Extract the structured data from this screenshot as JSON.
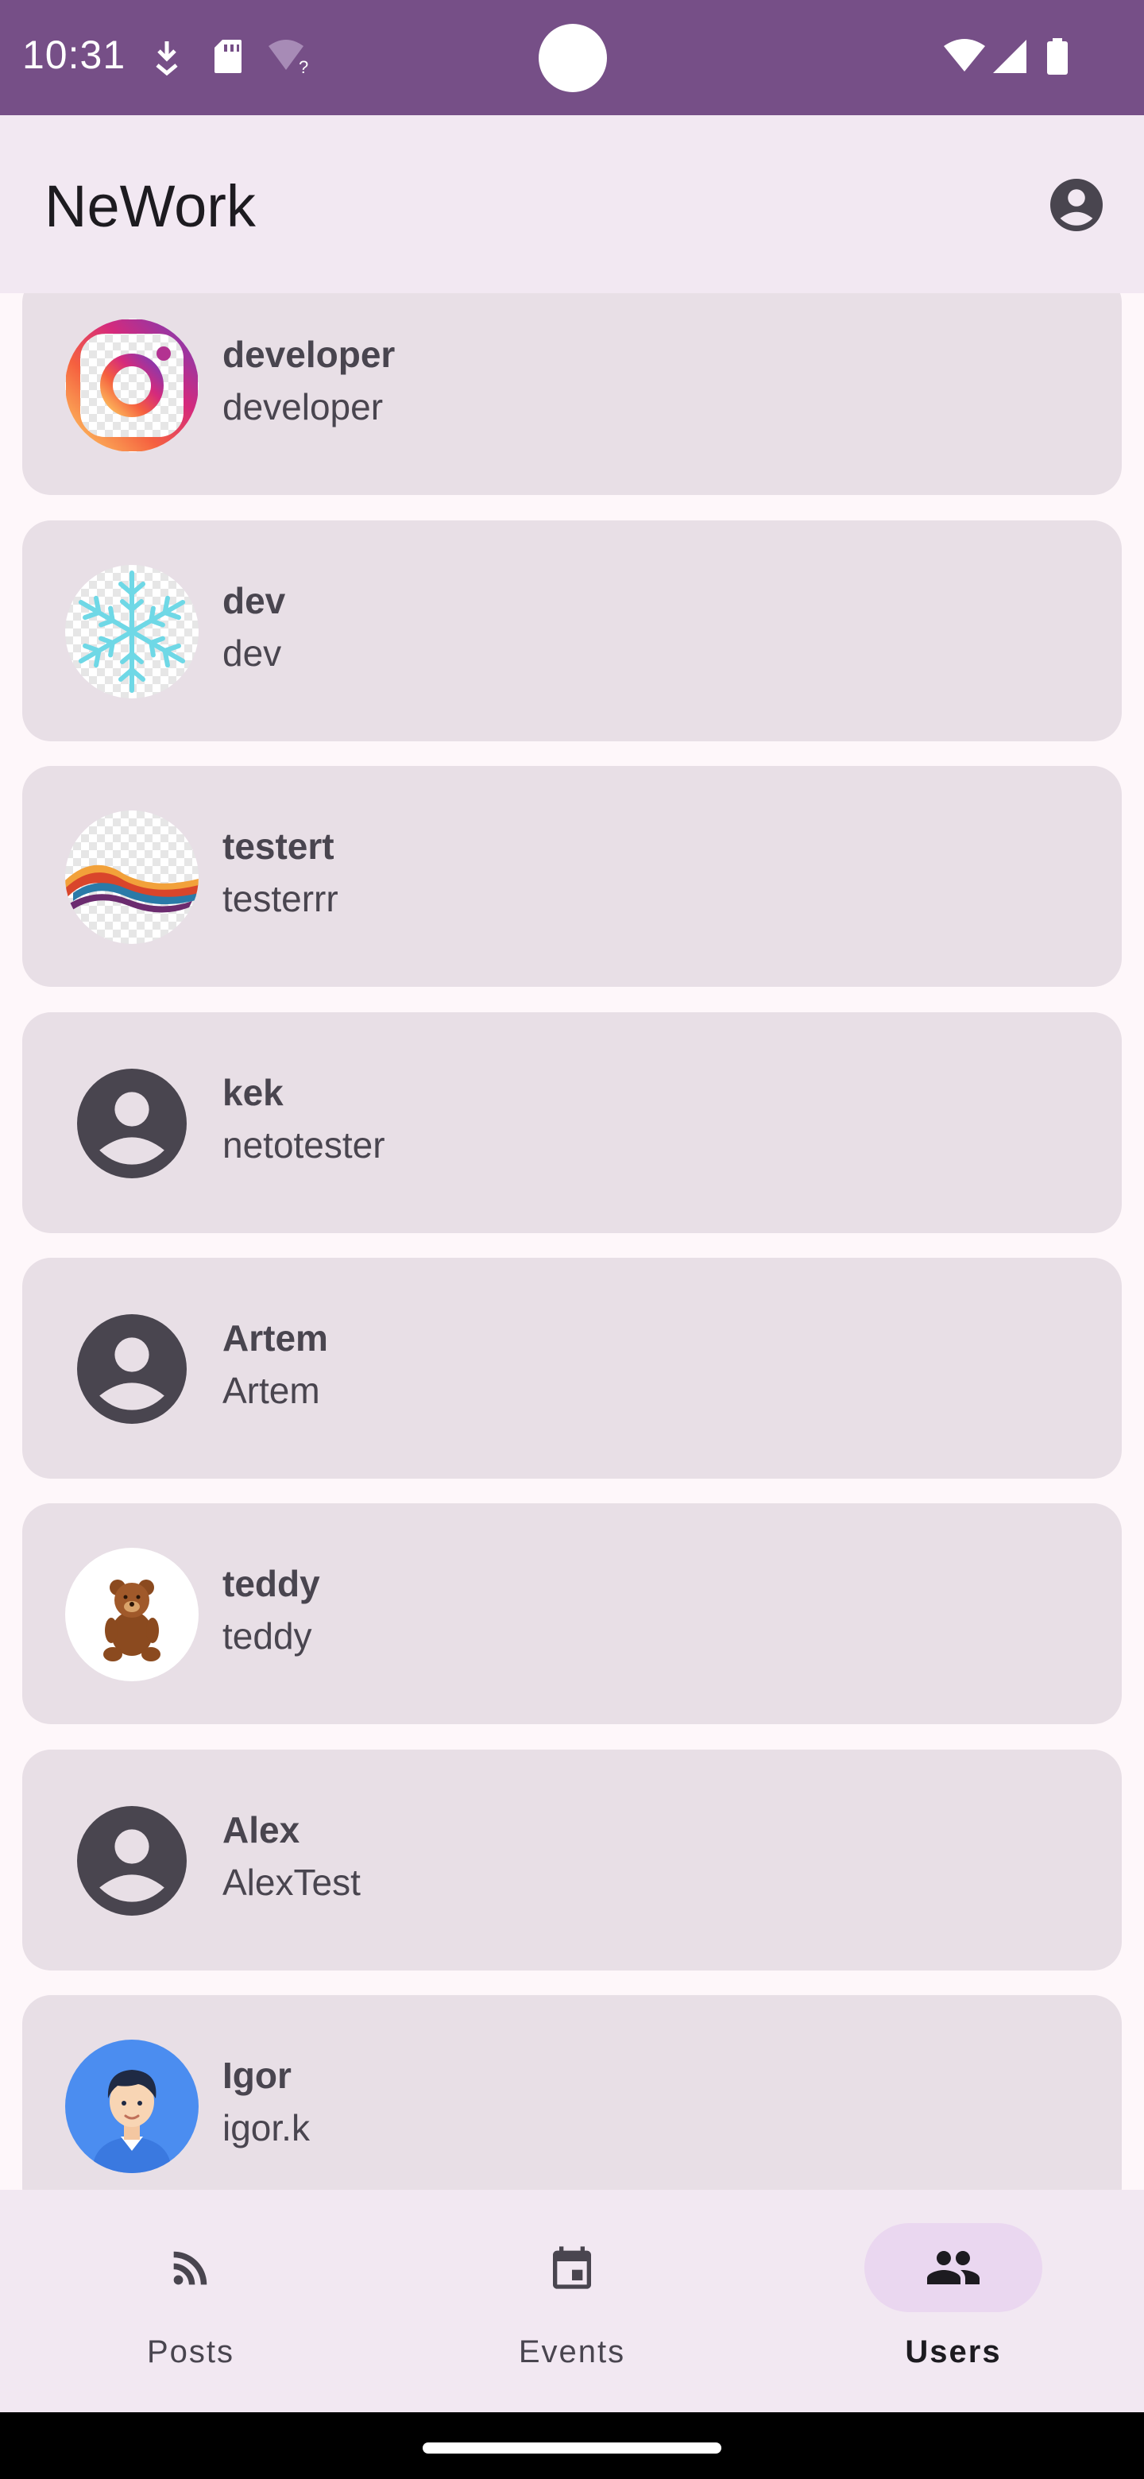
{
  "status_bar": {
    "time": "10:31",
    "icons_left": [
      "download-icon",
      "sd-card-icon",
      "wifi-unknown-icon"
    ],
    "icons_right": [
      "wifi-icon",
      "cellular-icon",
      "battery-icon"
    ],
    "background": "#764f87"
  },
  "app_bar": {
    "title": "NeWork",
    "account_icon": "account-circle-icon"
  },
  "users": [
    {
      "name": "developer",
      "login": "developer",
      "avatar": "instagram-logo-avatar"
    },
    {
      "name": "dev",
      "login": "dev",
      "avatar": "snowflake-avatar"
    },
    {
      "name": "testert",
      "login": "testerrr",
      "avatar": "ribbon-swirl-avatar"
    },
    {
      "name": "kek",
      "login": "netotester",
      "avatar": "default-account-avatar"
    },
    {
      "name": "Artem",
      "login": "Artem",
      "avatar": "default-account-avatar"
    },
    {
      "name": "teddy",
      "login": "teddy",
      "avatar": "teddy-bear-avatar"
    },
    {
      "name": "Alex",
      "login": "AlexTest",
      "avatar": "default-account-avatar"
    },
    {
      "name": "Igor",
      "login": "igor.k",
      "avatar": "cartoon-boy-avatar"
    }
  ],
  "bottom_nav": {
    "items": [
      {
        "label": "Posts",
        "icon": "rss-feed-icon",
        "active": false
      },
      {
        "label": "Events",
        "icon": "calendar-event-icon",
        "active": false
      },
      {
        "label": "Users",
        "icon": "people-icon",
        "active": true
      }
    ]
  },
  "colors": {
    "card": "#e8dfe6",
    "app_bar": "#f2e8f2",
    "active_indicator": "#ead7f0",
    "text": "#49454f"
  }
}
